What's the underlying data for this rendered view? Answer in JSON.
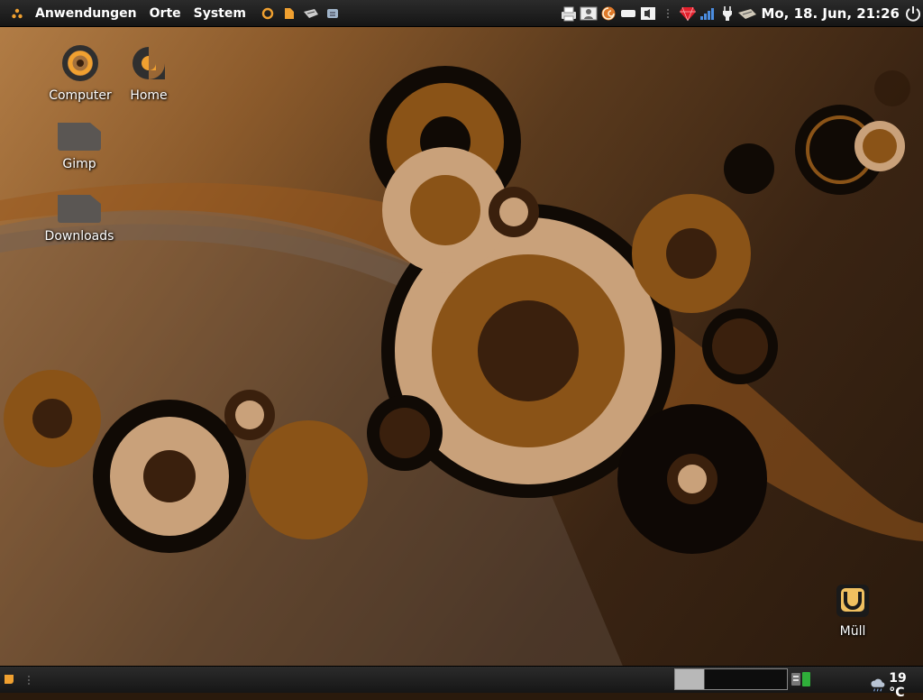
{
  "top_panel": {
    "menus": [
      "Anwendungen",
      "Orte",
      "System"
    ],
    "clock": "Mo, 18. Jun, 21:26",
    "launchers": [
      "firefox-icon",
      "folder-icon",
      "mail-icon",
      "network-icon"
    ],
    "tray": [
      "printer-icon",
      "user-switch-icon",
      "shell-icon",
      "disk-icon",
      "volume-icon",
      "separator-icon",
      "ruby-icon",
      "signal-icon",
      "power-plug-icon",
      "mouse-icon",
      "shutdown-icon"
    ]
  },
  "desktop": {
    "icons": [
      {
        "label": "Computer",
        "icon": "computer-icon"
      },
      {
        "label": "Home",
        "icon": "home-icon"
      },
      {
        "label": "Gimp",
        "icon": "folder-icon"
      },
      {
        "label": "Downloads",
        "icon": "folder-icon"
      },
      {
        "label": "Müll",
        "icon": "trash-icon"
      }
    ]
  },
  "bottom_panel": {
    "weather_temp": "19 °C",
    "workspaces": 2,
    "active_workspace": 1
  },
  "colors": {
    "accent": "#f0a030",
    "dark_brown": "#3a200d",
    "mid_brown": "#8a5317",
    "tan": "#d9ab7c",
    "panel": "#1f1f1f"
  }
}
